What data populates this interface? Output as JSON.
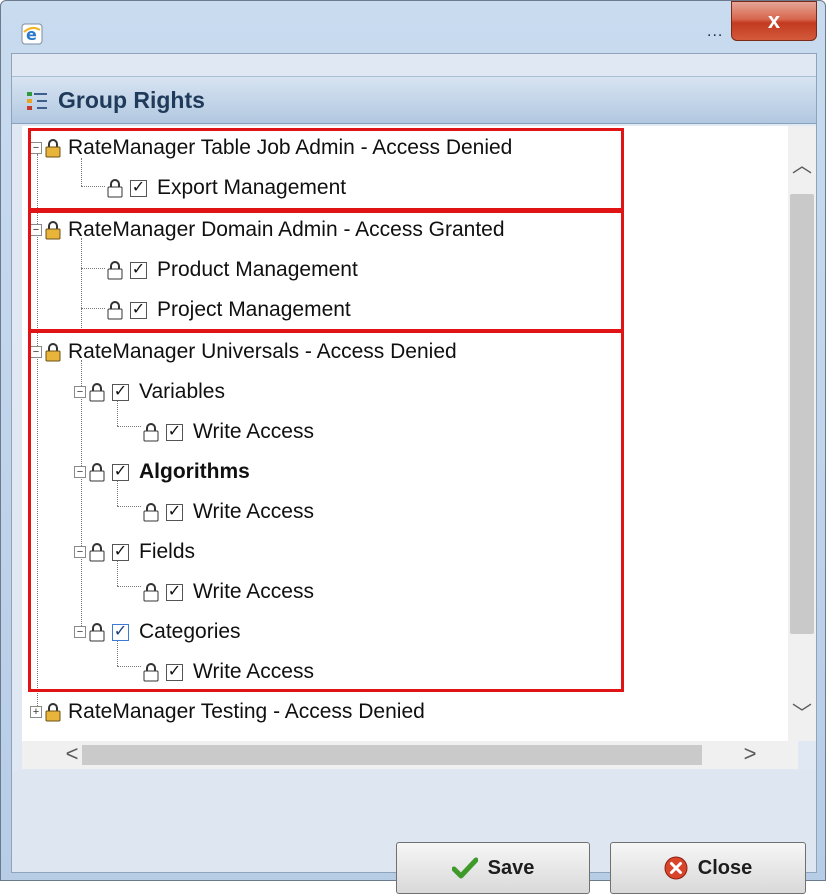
{
  "window": {
    "title_dots": "...",
    "close_glyph": "x"
  },
  "panel": {
    "title": "Group Rights",
    "icon": "tree-list-icon"
  },
  "tree": {
    "groups": [
      {
        "label": "RateManager Table Job Admin - Access Denied",
        "expander": "−"
      },
      {
        "label": "Export Management",
        "checked": true
      },
      {
        "label": "RateManager Domain Admin - Access Granted",
        "expander": "−"
      },
      {
        "label": "Product Management",
        "checked": true
      },
      {
        "label": "Project Management",
        "checked": true
      },
      {
        "label": "RateManager Universals - Access Denied",
        "expander": "−"
      },
      {
        "label": "Variables",
        "checked": true,
        "expander": "−"
      },
      {
        "label": "Write Access",
        "checked": true
      },
      {
        "label": "Algorithms",
        "checked": true,
        "expander": "−"
      },
      {
        "label": "Write Access",
        "checked": true
      },
      {
        "label": "Fields",
        "checked": true,
        "expander": "−"
      },
      {
        "label": "Write Access",
        "checked": true
      },
      {
        "label": "Categories",
        "checked": true,
        "expander": "−"
      },
      {
        "label": "Write Access",
        "checked": true
      },
      {
        "label": "RateManager Testing - Access Denied",
        "expander": "+"
      }
    ],
    "check_glyph": "✓"
  },
  "scrollbars": {
    "up": "︿",
    "down": "﹀",
    "left": "<",
    "right": ">"
  },
  "buttons": {
    "save": "Save",
    "close": "Close"
  },
  "colors": {
    "highlight_frame": "#e01414",
    "header_text": "#1f3a5a",
    "close_button": "#c23a20"
  }
}
